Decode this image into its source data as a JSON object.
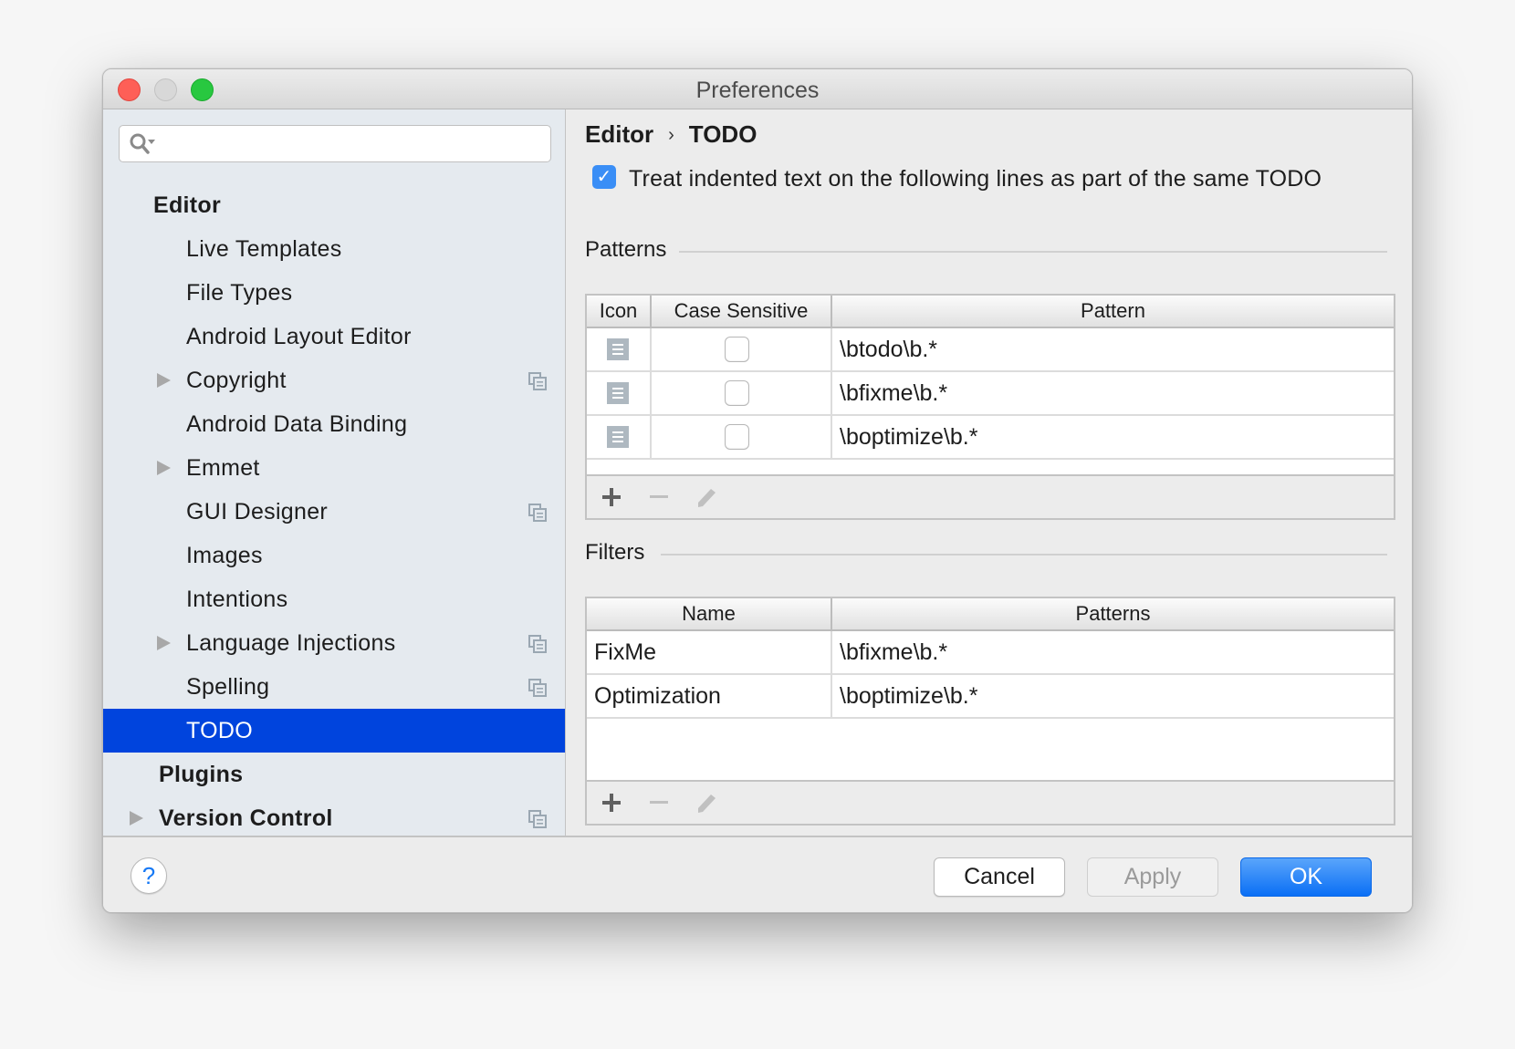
{
  "window": {
    "title": "Preferences"
  },
  "sidebar": {
    "search": {
      "value": "",
      "placeholder": ""
    },
    "items": [
      {
        "label": "Editor",
        "level": 0,
        "bold": true,
        "expandable": false,
        "project_scoped": false,
        "selected": false
      },
      {
        "label": "Live Templates",
        "level": 1,
        "bold": false,
        "expandable": false,
        "project_scoped": false,
        "selected": false
      },
      {
        "label": "File Types",
        "level": 1,
        "bold": false,
        "expandable": false,
        "project_scoped": false,
        "selected": false
      },
      {
        "label": "Android Layout Editor",
        "level": 1,
        "bold": false,
        "expandable": false,
        "project_scoped": false,
        "selected": false
      },
      {
        "label": "Copyright",
        "level": 1,
        "bold": false,
        "expandable": true,
        "project_scoped": true,
        "selected": false
      },
      {
        "label": "Android Data Binding",
        "level": 1,
        "bold": false,
        "expandable": false,
        "project_scoped": false,
        "selected": false
      },
      {
        "label": "Emmet",
        "level": 1,
        "bold": false,
        "expandable": true,
        "project_scoped": false,
        "selected": false
      },
      {
        "label": "GUI Designer",
        "level": 1,
        "bold": false,
        "expandable": false,
        "project_scoped": true,
        "selected": false
      },
      {
        "label": "Images",
        "level": 1,
        "bold": false,
        "expandable": false,
        "project_scoped": false,
        "selected": false
      },
      {
        "label": "Intentions",
        "level": 1,
        "bold": false,
        "expandable": false,
        "project_scoped": false,
        "selected": false
      },
      {
        "label": "Language Injections",
        "level": 1,
        "bold": false,
        "expandable": true,
        "project_scoped": true,
        "selected": false
      },
      {
        "label": "Spelling",
        "level": 1,
        "bold": false,
        "expandable": false,
        "project_scoped": true,
        "selected": false
      },
      {
        "label": "TODO",
        "level": 1,
        "bold": false,
        "expandable": false,
        "project_scoped": false,
        "selected": true
      },
      {
        "label": "Plugins",
        "level": 0,
        "bold": true,
        "expandable": false,
        "project_scoped": false,
        "selected": false
      },
      {
        "label": "Version Control",
        "level": 0,
        "bold": true,
        "expandable": true,
        "project_scoped": true,
        "selected": false
      }
    ]
  },
  "content": {
    "breadcrumb": {
      "parent": "Editor",
      "separator": "›",
      "current": "TODO"
    },
    "treat_indented": {
      "label": "Treat indented text on the following lines as part of the same TODO",
      "checked": true
    },
    "patterns": {
      "section_title": "Patterns",
      "columns": [
        "Icon",
        "Case Sensitive",
        "Pattern"
      ],
      "rows": [
        {
          "icon": "todo-list-icon",
          "case_sensitive": false,
          "pattern": "\\btodo\\b.*"
        },
        {
          "icon": "todo-list-icon",
          "case_sensitive": false,
          "pattern": "\\bfixme\\b.*"
        },
        {
          "icon": "todo-list-icon",
          "case_sensitive": false,
          "pattern": "\\boptimize\\b.*"
        }
      ],
      "toolbar": {
        "add": "+",
        "remove": "−",
        "edit": "edit"
      }
    },
    "filters": {
      "section_title": "Filters",
      "columns": [
        "Name",
        "Patterns"
      ],
      "rows": [
        {
          "name": "FixMe",
          "patterns": "\\bfixme\\b.*"
        },
        {
          "name": "Optimization",
          "patterns": "\\boptimize\\b.*"
        }
      ],
      "toolbar": {
        "add": "+",
        "remove": "−",
        "edit": "edit"
      }
    }
  },
  "footer": {
    "help_label": "?",
    "cancel_label": "Cancel",
    "apply_label": "Apply",
    "ok_label": "OK",
    "apply_enabled": false
  },
  "colors": {
    "selection": "#0044dd",
    "accent": "#1578f5",
    "checkbox_checked": "#3a8ef6"
  }
}
